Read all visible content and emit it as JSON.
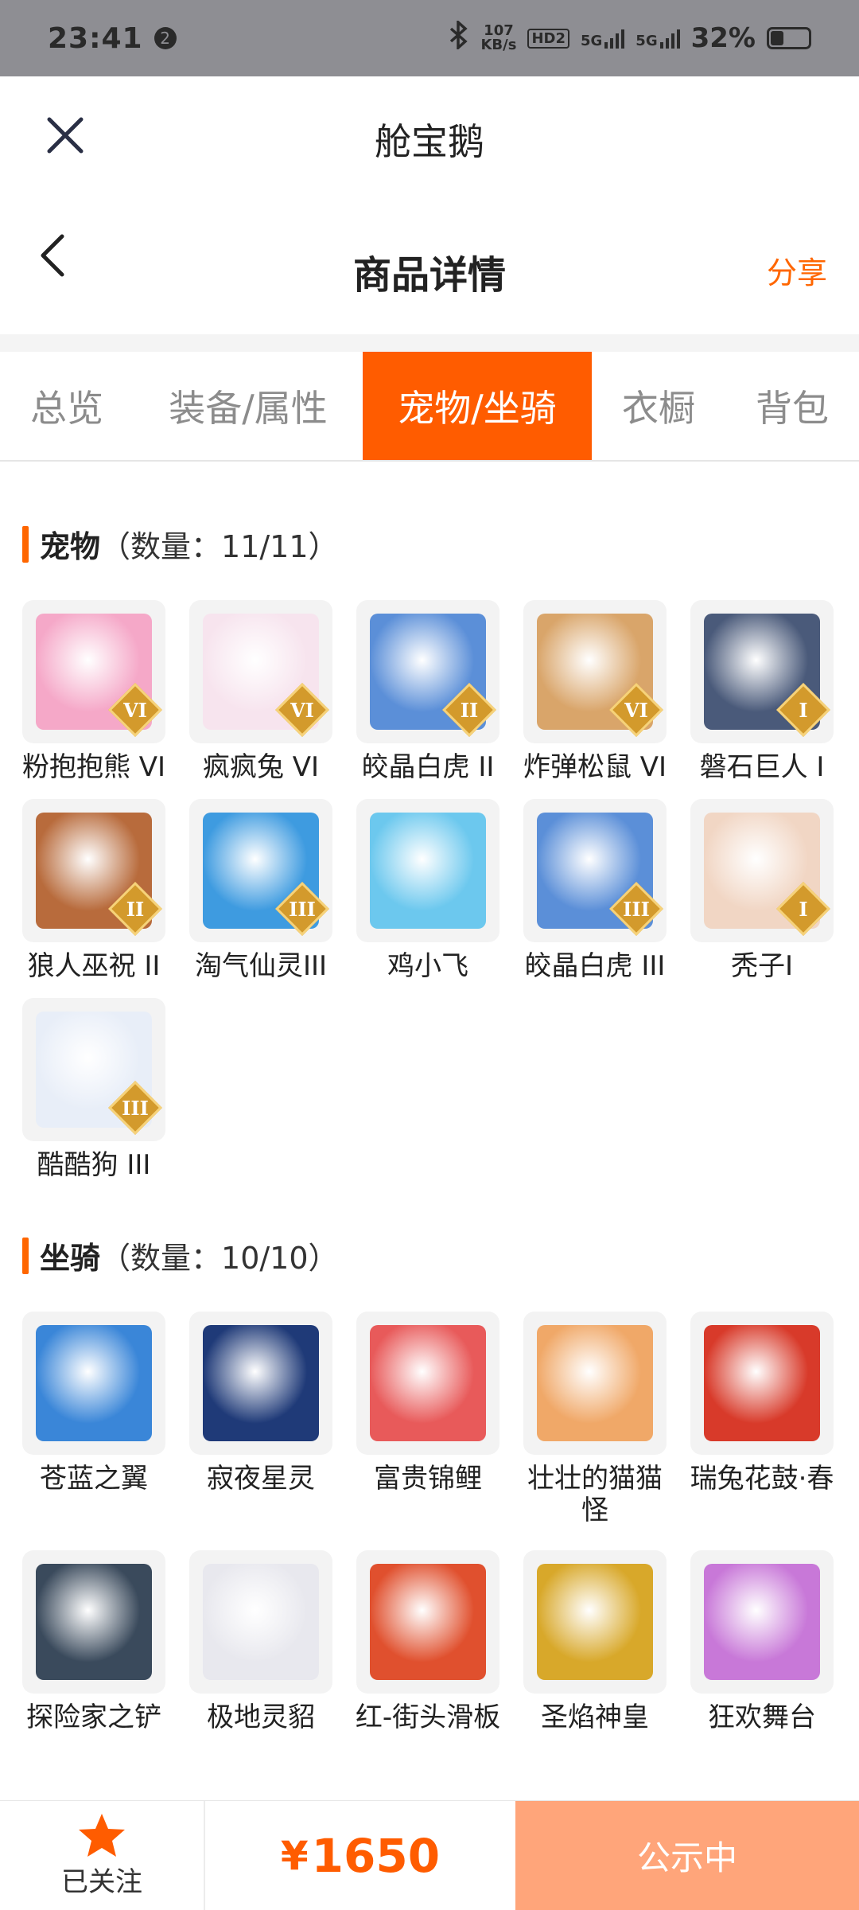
{
  "status_bar": {
    "time": "23:41",
    "badge": "2",
    "speed_value": "107",
    "speed_unit": "KB/s",
    "hd": "HD2",
    "net1": "5G",
    "net2": "5G",
    "battery": "32%"
  },
  "header": {
    "title": "舱宝鹅"
  },
  "nav": {
    "title": "商品详情",
    "share": "分享"
  },
  "tabs": [
    {
      "label": "总览",
      "active": false
    },
    {
      "label": "装备/属性",
      "active": false
    },
    {
      "label": "宠物/坐骑",
      "active": true
    },
    {
      "label": "衣橱",
      "active": false
    },
    {
      "label": "背包",
      "active": false
    }
  ],
  "pets": {
    "title": "宠物",
    "count": "（数量：11/11）",
    "items": [
      {
        "name": "粉抱抱熊 VI",
        "tier": "VI",
        "color": "#f5a8c8"
      },
      {
        "name": "疯疯兔 VI",
        "tier": "VI",
        "color": "#f7e4ee"
      },
      {
        "name": "皎晶白虎 II",
        "tier": "II",
        "color": "#5b8fd8"
      },
      {
        "name": "炸弹松鼠 VI",
        "tier": "VI",
        "color": "#d9a56a"
      },
      {
        "name": "磐石巨人 I",
        "tier": "I",
        "color": "#4a5a7a"
      },
      {
        "name": "狼人巫祝 II",
        "tier": "II",
        "color": "#b86b3c"
      },
      {
        "name": "淘气仙灵III",
        "tier": "III",
        "color": "#3e9be0"
      },
      {
        "name": "鸡小飞",
        "tier": "",
        "color": "#6cc8ee"
      },
      {
        "name": "皎晶白虎 III",
        "tier": "III",
        "color": "#5b8fd8"
      },
      {
        "name": "秃子I",
        "tier": "I",
        "color": "#f1d6c4"
      },
      {
        "name": "酷酷狗 III",
        "tier": "III",
        "color": "#e8eef8"
      }
    ]
  },
  "mounts": {
    "title": "坐骑",
    "count": "（数量：10/10）",
    "items": [
      {
        "name": "苍蓝之翼",
        "color": "#3a86d8"
      },
      {
        "name": "寂夜星灵",
        "color": "#1f3a78"
      },
      {
        "name": "富贵锦鲤",
        "color": "#e85a5a"
      },
      {
        "name": "壮壮的猫猫怪",
        "color": "#f0a868"
      },
      {
        "name": "瑞兔花鼓·春",
        "color": "#d83a2a"
      },
      {
        "name": "探险家之铲",
        "color": "#3a4a5c"
      },
      {
        "name": "极地灵貂",
        "color": "#e8e8ee"
      },
      {
        "name": "红-街头滑板",
        "color": "#e0502e"
      },
      {
        "name": "圣焰神皇",
        "color": "#d8a82a"
      },
      {
        "name": "狂欢舞台",
        "color": "#c878d8"
      }
    ]
  },
  "bottom": {
    "follow_label": "已关注",
    "price_symbol": "¥",
    "price": "1650",
    "status": "公示中",
    "accent": "#ff5c00"
  }
}
